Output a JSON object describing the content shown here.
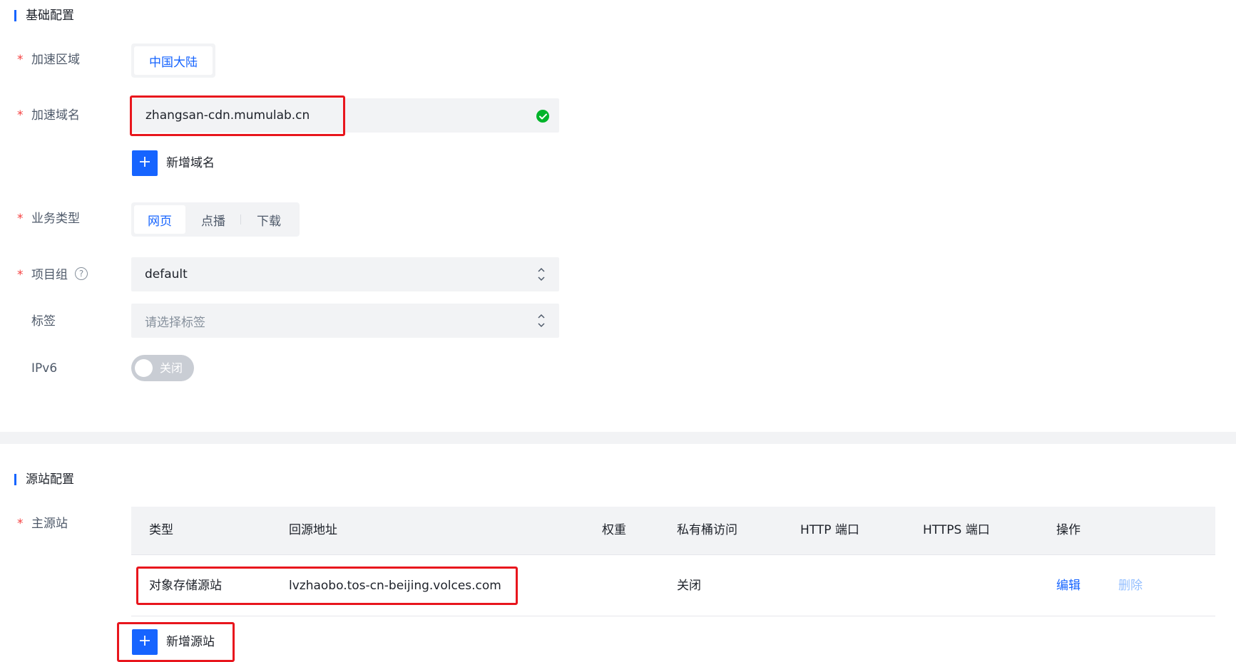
{
  "basic_section": {
    "title": "基础配置",
    "region": {
      "label": "加速区域",
      "value": "中国大陆"
    },
    "domain": {
      "label": "加速域名",
      "value": "zhangsan-cdn.mumulab.cn",
      "add_label": "新增域名"
    },
    "business_type": {
      "label": "业务类型",
      "options": [
        "网页",
        "点播",
        "下载"
      ],
      "selected": "网页"
    },
    "project_group": {
      "label": "项目组",
      "value": "default"
    },
    "tags": {
      "label": "标签",
      "placeholder": "请选择标签"
    },
    "ipv6": {
      "label": "IPv6",
      "state_text": "关闭"
    }
  },
  "origin_section": {
    "title": "源站配置",
    "primary_label": "主源站",
    "table": {
      "columns": [
        "类型",
        "回源地址",
        "权重",
        "私有桶访问",
        "HTTP 端口",
        "HTTPS 端口",
        "操作"
      ],
      "rows": [
        {
          "type": "对象存储源站",
          "address": "lvzhaobo.tos-cn-beijing.volces.com",
          "weight": "",
          "private_bucket": "关闭",
          "http_port": "",
          "https_port": "",
          "edit": "编辑",
          "delete": "删除"
        }
      ]
    },
    "add_label": "新增源站"
  },
  "colors": {
    "primary": "#1664ff",
    "required": "#f53f3f",
    "highlight": "#e8161d",
    "success": "#00b42a"
  }
}
